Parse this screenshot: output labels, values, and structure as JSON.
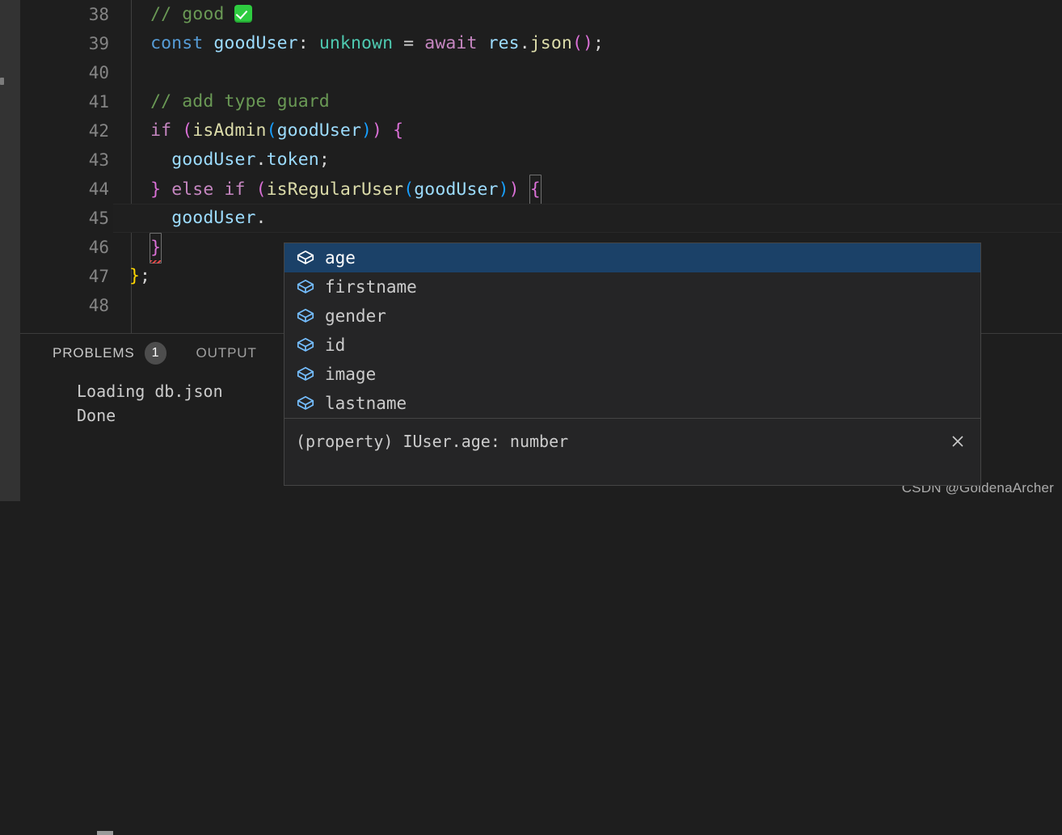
{
  "editor": {
    "language": "typescript",
    "lines": [
      {
        "number": "38",
        "indent": 1,
        "tokens": [
          {
            "t": "// good ",
            "c": "comment"
          },
          {
            "t": "✅",
            "c": "emoji-check"
          }
        ]
      },
      {
        "number": "39",
        "indent": 1,
        "tokens": [
          {
            "t": "const",
            "c": "keyword"
          },
          {
            "t": " ",
            "c": "plain"
          },
          {
            "t": "goodUser",
            "c": "variable"
          },
          {
            "t": ": ",
            "c": "plain"
          },
          {
            "t": "unknown",
            "c": "type"
          },
          {
            "t": " = ",
            "c": "plain"
          },
          {
            "t": "await",
            "c": "control"
          },
          {
            "t": " ",
            "c": "plain"
          },
          {
            "t": "res",
            "c": "variable"
          },
          {
            "t": ".",
            "c": "plain"
          },
          {
            "t": "json",
            "c": "function"
          },
          {
            "t": "()",
            "c": "bracket-magenta"
          },
          {
            "t": ";",
            "c": "plain"
          }
        ]
      },
      {
        "number": "40",
        "indent": 1,
        "tokens": []
      },
      {
        "number": "41",
        "indent": 1,
        "tokens": [
          {
            "t": "// add type guard",
            "c": "comment"
          }
        ]
      },
      {
        "number": "42",
        "indent": 1,
        "tokens": [
          {
            "t": "if",
            "c": "control"
          },
          {
            "t": " ",
            "c": "plain"
          },
          {
            "t": "(",
            "c": "bracket-magenta"
          },
          {
            "t": "isAdmin",
            "c": "function"
          },
          {
            "t": "(",
            "c": "bracket-blue"
          },
          {
            "t": "goodUser",
            "c": "variable"
          },
          {
            "t": ")",
            "c": "bracket-blue"
          },
          {
            "t": ")",
            "c": "bracket-magenta"
          },
          {
            "t": " ",
            "c": "plain"
          },
          {
            "t": "{",
            "c": "bracket-magenta"
          }
        ]
      },
      {
        "number": "43",
        "indent": 2,
        "tokens": [
          {
            "t": "goodUser",
            "c": "variable"
          },
          {
            "t": ".",
            "c": "plain"
          },
          {
            "t": "token",
            "c": "variable"
          },
          {
            "t": ";",
            "c": "plain"
          }
        ]
      },
      {
        "number": "44",
        "indent": 1,
        "tokens": [
          {
            "t": "}",
            "c": "bracket-magenta"
          },
          {
            "t": " ",
            "c": "plain"
          },
          {
            "t": "else",
            "c": "control"
          },
          {
            "t": " ",
            "c": "plain"
          },
          {
            "t": "if",
            "c": "control"
          },
          {
            "t": " ",
            "c": "plain"
          },
          {
            "t": "(",
            "c": "bracket-magenta"
          },
          {
            "t": "isRegularUser",
            "c": "function"
          },
          {
            "t": "(",
            "c": "bracket-blue"
          },
          {
            "t": "goodUser",
            "c": "variable"
          },
          {
            "t": ")",
            "c": "bracket-blue"
          },
          {
            "t": ")",
            "c": "bracket-magenta"
          },
          {
            "t": " ",
            "c": "plain"
          },
          {
            "t": "{",
            "c": "bracket-magenta-boxed"
          }
        ]
      },
      {
        "number": "45",
        "indent": 2,
        "current": true,
        "tokens": [
          {
            "t": "goodUser",
            "c": "variable"
          },
          {
            "t": ".",
            "c": "plain"
          }
        ]
      },
      {
        "number": "46",
        "indent": 1,
        "tokens": [
          {
            "t": "}",
            "c": "bracket-magenta-boxed-error"
          }
        ]
      },
      {
        "number": "47",
        "indent": 0,
        "tokens": [
          {
            "t": "}",
            "c": "bracket-yellow"
          },
          {
            "t": ";",
            "c": "plain"
          }
        ]
      },
      {
        "number": "48",
        "indent": 0,
        "tokens": []
      }
    ]
  },
  "suggest": {
    "items": [
      {
        "label": "age",
        "icon": "symbol-field-icon",
        "selected": true
      },
      {
        "label": "firstname",
        "icon": "symbol-field-icon",
        "selected": false
      },
      {
        "label": "gender",
        "icon": "symbol-field-icon",
        "selected": false
      },
      {
        "label": "id",
        "icon": "symbol-field-icon",
        "selected": false
      },
      {
        "label": "image",
        "icon": "symbol-field-icon",
        "selected": false
      },
      {
        "label": "lastname",
        "icon": "symbol-field-icon",
        "selected": false
      }
    ],
    "detail": "(property) IUser.age: number",
    "close_icon": "close-icon",
    "selected_bg": "#1b4168"
  },
  "panel": {
    "tabs": [
      {
        "label": "PROBLEMS",
        "badge": "1",
        "active": true
      },
      {
        "label": "OUTPUT",
        "badge": "",
        "active": false
      }
    ],
    "terminal_lines": [
      "Loading db.json",
      "Done"
    ]
  },
  "watermark": "CSDN @GoldenaArcher",
  "colors": {
    "editor_bg": "#1e1e1e",
    "activity_bg": "#333333",
    "comment": "#6a9955",
    "keyword": "#569cd6",
    "control": "#c586c0",
    "variable": "#9cdcfe",
    "type": "#4ec9b0",
    "function": "#dcdcaa",
    "bracket_magenta": "#da70d6",
    "bracket_blue": "#179fff",
    "bracket_yellow": "#ffd700",
    "error_squiggle": "#f14c4c"
  }
}
